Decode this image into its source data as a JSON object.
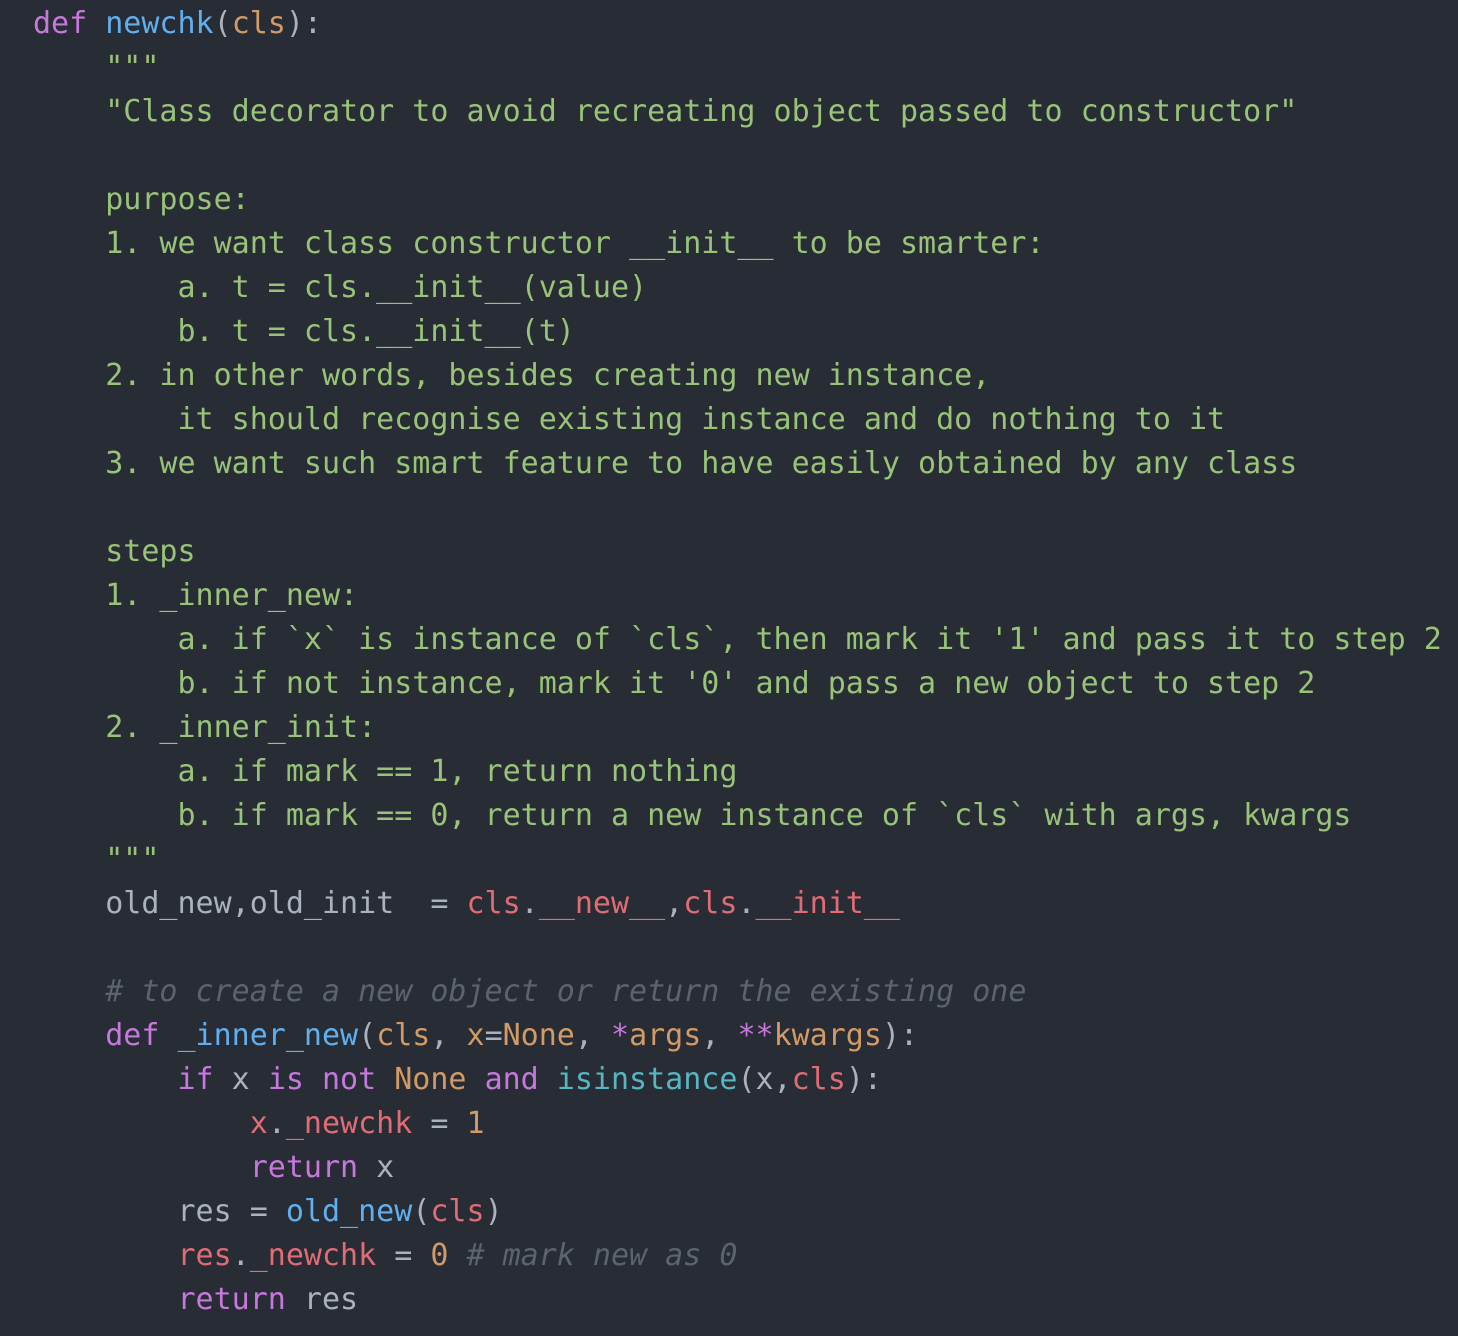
{
  "code": {
    "language": "python",
    "lines": [
      {
        "tokens": [
          {
            "t": "def",
            "c": "keyword"
          },
          {
            "t": " ",
            "c": "plain"
          },
          {
            "t": "newchk",
            "c": "function"
          },
          {
            "t": "(",
            "c": "punct"
          },
          {
            "t": "cls",
            "c": "param"
          },
          {
            "t": "):",
            "c": "punct"
          }
        ]
      },
      {
        "tokens": [
          {
            "t": "    \"\"\"",
            "c": "string"
          }
        ]
      },
      {
        "tokens": [
          {
            "t": "    \"Class decorator to avoid recreating object passed to constructor\"",
            "c": "string"
          }
        ]
      },
      {
        "tokens": []
      },
      {
        "tokens": [
          {
            "t": "    purpose:",
            "c": "string"
          }
        ]
      },
      {
        "tokens": [
          {
            "t": "    1. we want class constructor __init__ to be smarter:",
            "c": "string"
          }
        ]
      },
      {
        "tokens": [
          {
            "t": "        a. t = cls.__init__(value)",
            "c": "string"
          }
        ]
      },
      {
        "tokens": [
          {
            "t": "        b. t = cls.__init__(t)",
            "c": "string"
          }
        ]
      },
      {
        "tokens": [
          {
            "t": "    2. in other words, besides creating new instance,",
            "c": "string"
          }
        ]
      },
      {
        "tokens": [
          {
            "t": "        it should recognise existing instance and do nothing to it",
            "c": "string"
          }
        ]
      },
      {
        "tokens": [
          {
            "t": "    3. we want such smart feature to have easily obtained by any class",
            "c": "string"
          }
        ]
      },
      {
        "tokens": []
      },
      {
        "tokens": [
          {
            "t": "    steps",
            "c": "string"
          }
        ]
      },
      {
        "tokens": [
          {
            "t": "    1. _inner_new:",
            "c": "string"
          }
        ]
      },
      {
        "tokens": [
          {
            "t": "        a. if `x` is instance of `cls`, then mark it '1' and pass it to step 2",
            "c": "string"
          }
        ]
      },
      {
        "tokens": [
          {
            "t": "        b. if not instance, mark it '0' and pass a new object to step 2",
            "c": "string"
          }
        ]
      },
      {
        "tokens": [
          {
            "t": "    2. _inner_init:",
            "c": "string"
          }
        ]
      },
      {
        "tokens": [
          {
            "t": "        a. if mark == 1, return nothing",
            "c": "string"
          }
        ]
      },
      {
        "tokens": [
          {
            "t": "        b. if mark == 0, return a new instance of `cls` with args, kwargs",
            "c": "string"
          }
        ]
      },
      {
        "tokens": [
          {
            "t": "    \"\"\"",
            "c": "string"
          }
        ]
      },
      {
        "tokens": [
          {
            "t": "    old_new,old_init  = ",
            "c": "plain"
          },
          {
            "t": "cls",
            "c": "self"
          },
          {
            "t": ".",
            "c": "punct"
          },
          {
            "t": "__new__",
            "c": "attr"
          },
          {
            "t": ",",
            "c": "punct"
          },
          {
            "t": "cls",
            "c": "self"
          },
          {
            "t": ".",
            "c": "punct"
          },
          {
            "t": "__init__",
            "c": "attr"
          }
        ]
      },
      {
        "tokens": []
      },
      {
        "tokens": [
          {
            "t": "    # to create a new object or return the existing one",
            "c": "comment"
          }
        ]
      },
      {
        "tokens": [
          {
            "t": "    ",
            "c": "plain"
          },
          {
            "t": "def",
            "c": "keyword"
          },
          {
            "t": " ",
            "c": "plain"
          },
          {
            "t": "_inner_new",
            "c": "function"
          },
          {
            "t": "(",
            "c": "punct"
          },
          {
            "t": "cls",
            "c": "param"
          },
          {
            "t": ", ",
            "c": "punct"
          },
          {
            "t": "x",
            "c": "param"
          },
          {
            "t": "=",
            "c": "punct"
          },
          {
            "t": "None",
            "c": "constant"
          },
          {
            "t": ", ",
            "c": "punct"
          },
          {
            "t": "*",
            "c": "keyword"
          },
          {
            "t": "args",
            "c": "param"
          },
          {
            "t": ", ",
            "c": "punct"
          },
          {
            "t": "**",
            "c": "keyword"
          },
          {
            "t": "kwargs",
            "c": "param"
          },
          {
            "t": "):",
            "c": "punct"
          }
        ]
      },
      {
        "tokens": [
          {
            "t": "        ",
            "c": "plain"
          },
          {
            "t": "if",
            "c": "keyword"
          },
          {
            "t": " x ",
            "c": "plain"
          },
          {
            "t": "is",
            "c": "keyword"
          },
          {
            "t": " ",
            "c": "plain"
          },
          {
            "t": "not",
            "c": "keyword"
          },
          {
            "t": " ",
            "c": "plain"
          },
          {
            "t": "None",
            "c": "constant"
          },
          {
            "t": " ",
            "c": "plain"
          },
          {
            "t": "and",
            "c": "keyword"
          },
          {
            "t": " ",
            "c": "plain"
          },
          {
            "t": "isinstance",
            "c": "builtin"
          },
          {
            "t": "(x,",
            "c": "punct"
          },
          {
            "t": "cls",
            "c": "self"
          },
          {
            "t": "):",
            "c": "punct"
          }
        ]
      },
      {
        "tokens": [
          {
            "t": "            ",
            "c": "plain"
          },
          {
            "t": "x",
            "c": "self"
          },
          {
            "t": ".",
            "c": "punct"
          },
          {
            "t": "_newchk",
            "c": "attr"
          },
          {
            "t": " = ",
            "c": "plain"
          },
          {
            "t": "1",
            "c": "number"
          }
        ]
      },
      {
        "tokens": [
          {
            "t": "            ",
            "c": "plain"
          },
          {
            "t": "return",
            "c": "keyword"
          },
          {
            "t": " x",
            "c": "plain"
          }
        ]
      },
      {
        "tokens": [
          {
            "t": "        res = ",
            "c": "plain"
          },
          {
            "t": "old_new",
            "c": "function"
          },
          {
            "t": "(",
            "c": "punct"
          },
          {
            "t": "cls",
            "c": "self"
          },
          {
            "t": ")",
            "c": "punct"
          }
        ]
      },
      {
        "tokens": [
          {
            "t": "        ",
            "c": "plain"
          },
          {
            "t": "res",
            "c": "self"
          },
          {
            "t": ".",
            "c": "punct"
          },
          {
            "t": "_newchk",
            "c": "attr"
          },
          {
            "t": " = ",
            "c": "plain"
          },
          {
            "t": "0",
            "c": "number"
          },
          {
            "t": " ",
            "c": "plain"
          },
          {
            "t": "# mark new as 0",
            "c": "comment"
          }
        ]
      },
      {
        "tokens": [
          {
            "t": "        ",
            "c": "plain"
          },
          {
            "t": "return",
            "c": "keyword"
          },
          {
            "t": " res",
            "c": "plain"
          }
        ]
      }
    ]
  },
  "colors": {
    "background": "#282c34",
    "keyword": "#c678dd",
    "function": "#61afef",
    "string": "#98c379",
    "param": "#d19a66",
    "self": "#e06c75",
    "comment": "#5c6370",
    "builtin": "#56b6c2",
    "plain": "#abb2bf"
  }
}
